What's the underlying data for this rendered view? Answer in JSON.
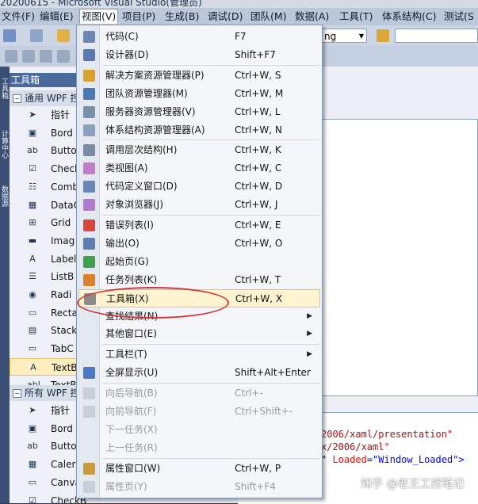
{
  "window": {
    "title": "20200615 - Microsoft Visual Studio(管理员)"
  },
  "menubar": [
    {
      "label": "文件(F)"
    },
    {
      "label": "编辑(E)"
    },
    {
      "label": "视图(V)"
    },
    {
      "label": "项目(P)"
    },
    {
      "label": "生成(B)"
    },
    {
      "label": "调试(D)"
    },
    {
      "label": "团队(M)"
    },
    {
      "label": "数据(A)"
    },
    {
      "label": "工具(T)"
    },
    {
      "label": "体系结构(C)"
    },
    {
      "label": "测试(S"
    }
  ],
  "toolbar": {
    "config_combo_value": "ng"
  },
  "sidebar_tabs": [
    "工具箱",
    "计算中心",
    "数据源"
  ],
  "toolbox": {
    "title": "工具箱",
    "cat_common": "通用 WPF 控",
    "common_items": [
      {
        "label": "指针",
        "icon": "pointer-icon",
        "glyph": "➤"
      },
      {
        "label": "Bord",
        "icon": "border-icon",
        "glyph": "▣"
      },
      {
        "label": "Butto",
        "icon": "button-icon",
        "glyph": "ab"
      },
      {
        "label": "Checl",
        "icon": "checkbox-icon",
        "glyph": "☑"
      },
      {
        "label": "Comb",
        "icon": "combobox-icon",
        "glyph": "☷"
      },
      {
        "label": "DataG",
        "icon": "datagrid-icon",
        "glyph": "▦"
      },
      {
        "label": "Grid",
        "icon": "grid-icon",
        "glyph": "⊞"
      },
      {
        "label": "Imag",
        "icon": "image-icon",
        "glyph": "▬"
      },
      {
        "label": "Label",
        "icon": "label-icon",
        "glyph": "A"
      },
      {
        "label": "ListB",
        "icon": "listbox-icon",
        "glyph": "☰"
      },
      {
        "label": "Radi",
        "icon": "radiobutton-icon",
        "glyph": "◉"
      },
      {
        "label": "Recta",
        "icon": "rectangle-icon",
        "glyph": "▭"
      },
      {
        "label": "Stack",
        "icon": "stackpanel-icon",
        "glyph": "▤"
      },
      {
        "label": "TabC",
        "icon": "tabcontrol-icon",
        "glyph": "▭"
      },
      {
        "label": "TextB",
        "icon": "textblock-icon",
        "glyph": "A"
      },
      {
        "label": "TextB",
        "icon": "textbox-icon",
        "glyph": "abl"
      }
    ],
    "cat_all": "所有 WPF 控",
    "all_items": [
      {
        "label": "指针",
        "icon": "pointer-icon",
        "glyph": "➤"
      },
      {
        "label": "Bord",
        "icon": "border-icon",
        "glyph": "▣"
      },
      {
        "label": "Butto",
        "icon": "button-icon",
        "glyph": "ab"
      },
      {
        "label": "Caler",
        "icon": "calendar-icon",
        "glyph": "▦"
      },
      {
        "label": "Canva",
        "icon": "canvas-icon",
        "glyph": "▭"
      },
      {
        "label": "CheckBox",
        "icon": "checkbox-icon",
        "glyph": "☑"
      }
    ]
  },
  "view_menu": [
    {
      "label": "代码(C)",
      "shortcut": "F7",
      "icon": "code-icon",
      "color": "#6f86b4"
    },
    {
      "label": "设计器(D)",
      "shortcut": "Shift+F7",
      "icon": "designer-icon",
      "color": "#5b79ad"
    },
    {
      "sep": true
    },
    {
      "label": "解决方案资源管理器(P)",
      "shortcut": "Ctrl+W, S",
      "icon": "solution-explorer-icon",
      "color": "#d9a22e"
    },
    {
      "label": "团队资源管理器(M)",
      "shortcut": "Ctrl+W, M",
      "icon": "team-explorer-icon",
      "color": "#4c78b8"
    },
    {
      "label": "服务器资源管理器(V)",
      "shortcut": "Ctrl+W, L",
      "icon": "server-explorer-icon",
      "color": "#7a8fa8"
    },
    {
      "label": "体系结构资源管理器(A)",
      "shortcut": "Ctrl+W, N",
      "icon": "architecture-explorer-icon",
      "color": "#8aa0bc"
    },
    {
      "sep": true
    },
    {
      "label": "调用层次结构(H)",
      "shortcut": "Ctrl+W, K",
      "icon": "call-hierarchy-icon",
      "color": "#7b8aa0"
    },
    {
      "label": "类视图(A)",
      "shortcut": "Ctrl+W, C",
      "icon": "class-view-icon",
      "color": "#c37cc7"
    },
    {
      "label": "代码定义窗口(D)",
      "shortcut": "Ctrl+W, D",
      "icon": "code-definition-icon",
      "color": "#6b85b5"
    },
    {
      "label": "对象浏览器(J)",
      "shortcut": "Ctrl+W, J",
      "icon": "object-browser-icon",
      "color": "#b07ad0"
    },
    {
      "sep": true
    },
    {
      "label": "错误列表(I)",
      "shortcut": "Ctrl+W, E",
      "icon": "error-list-icon",
      "color": "#d9463a"
    },
    {
      "label": "输出(O)",
      "shortcut": "Ctrl+W, O",
      "icon": "output-icon",
      "color": "#5f7eaf"
    },
    {
      "label": "起始页(G)",
      "shortcut": "",
      "icon": "start-page-icon",
      "color": "#3ea04a"
    },
    {
      "label": "任务列表(K)",
      "shortcut": "Ctrl+W, T",
      "icon": "task-list-icon",
      "color": "#d9822a"
    },
    {
      "label": "工具箱(X)",
      "shortcut": "Ctrl+W, X",
      "icon": "toolbox-icon",
      "color": "#8c8c8c",
      "highlight": true
    },
    {
      "label": "查找结果(N)",
      "shortcut": "",
      "arrow": true
    },
    {
      "label": "其他窗口(E)",
      "shortcut": "",
      "arrow": true
    },
    {
      "sep": true
    },
    {
      "label": "工具栏(T)",
      "shortcut": "",
      "arrow": true
    },
    {
      "label": "全屏显示(U)",
      "shortcut": "Shift+Alt+Enter",
      "icon": "fullscreen-icon",
      "color": "#4a78c2"
    },
    {
      "sep": true
    },
    {
      "label": "向后导航(B)",
      "shortcut": "Ctrl+-",
      "icon": "navigate-back-icon",
      "color": "#c9cfd9",
      "disabled": true
    },
    {
      "label": "向前导航(F)",
      "shortcut": "Ctrl+Shift+-",
      "icon": "navigate-forward-icon",
      "color": "#c9cfd9",
      "disabled": true
    },
    {
      "label": "下一任务(X)",
      "shortcut": "",
      "disabled": true
    },
    {
      "label": "上一任务(R)",
      "shortcut": "",
      "disabled": true
    },
    {
      "sep": true
    },
    {
      "label": "属性窗口(W)",
      "shortcut": "Ctrl+W, P",
      "icon": "properties-window-icon",
      "color": "#c79a3b"
    },
    {
      "label": "属性页(Y)",
      "shortcut": "Shift+F4",
      "icon": "property-pages-icon",
      "color": "#c9cfd9",
      "disabled": true
    }
  ],
  "xaml": [
    "2006/xaml/presentation\"",
    "x/2006/xaml\"",
    {
      "pre": "\" ",
      "attr": "Loaded",
      "eq": "=",
      "val": "\"Window_Loaded\"",
      "post": ">"
    }
  ],
  "watermark": "知乎 @老王工控笔记"
}
